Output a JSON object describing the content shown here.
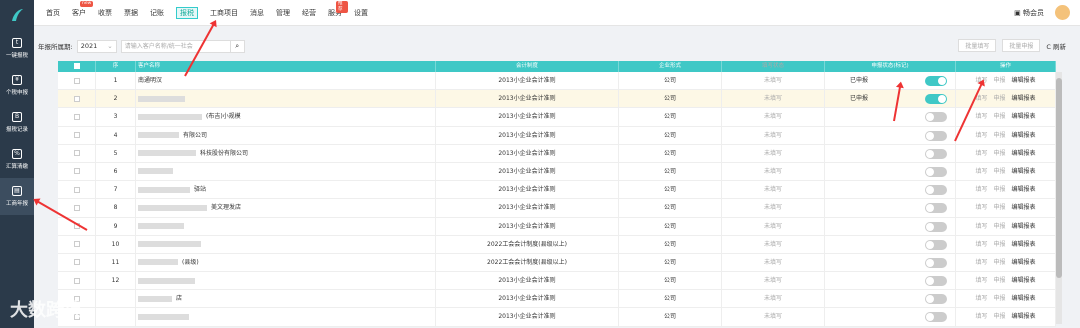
{
  "sidebar": {
    "items": [
      {
        "label": "一键报税",
        "icon": "t"
      },
      {
        "label": "个税申报",
        "icon": "¥"
      },
      {
        "label": "报税记录",
        "icon": "B"
      },
      {
        "label": "汇算清缴",
        "icon": "%"
      },
      {
        "label": "工商年报",
        "icon": "▤"
      }
    ]
  },
  "nav": {
    "items": [
      "首页",
      "客户",
      "收票",
      "票据",
      "记账",
      "报税",
      "工商项目",
      "消息",
      "管理",
      "经营",
      "服务",
      "设置"
    ],
    "badges": {
      "客户": "new",
      "服务": "推荐"
    },
    "active": "报税"
  },
  "member": "畅会员",
  "toolbar": {
    "period_label": "年报所属期:",
    "year": "2021",
    "search_placeholder": "请输入客户名称/统一社会",
    "btn1": "批量填写",
    "btn2": "批量申报",
    "refresh": "C 刷新"
  },
  "table": {
    "headers": [
      "",
      "序",
      "客户名称",
      "会计制度",
      "企业形式",
      "填写状态",
      "申报状态(标记)",
      "操作"
    ],
    "rows": [
      {
        "no": "1",
        "name": "南通明汉",
        "sys": "2013小企业会计准则",
        "form": "公司",
        "fill": "未填写",
        "status": "已申报",
        "on": true
      },
      {
        "no": "2",
        "name": "",
        "sys": "2013小企业会计准则",
        "form": "公司",
        "fill": "未填写",
        "status": "已申报",
        "on": true
      },
      {
        "no": "3",
        "name": "(布吉)小规模",
        "sys": "2013小企业会计准则",
        "form": "公司",
        "fill": "未填写",
        "status": "",
        "on": false
      },
      {
        "no": "4",
        "name": "有限公司",
        "sys": "2013小企业会计准则",
        "form": "公司",
        "fill": "未填写",
        "status": "",
        "on": false
      },
      {
        "no": "5",
        "name": "科技股份有限公司",
        "sys": "2013小企业会计准则",
        "form": "公司",
        "fill": "未填写",
        "status": "",
        "on": false
      },
      {
        "no": "6",
        "name": "",
        "sys": "2013小企业会计准则",
        "form": "公司",
        "fill": "未填写",
        "status": "",
        "on": false
      },
      {
        "no": "7",
        "name": "驿站",
        "sys": "2013小企业会计准则",
        "form": "公司",
        "fill": "未填写",
        "status": "",
        "on": false
      },
      {
        "no": "8",
        "name": "美文理发店",
        "sys": "2013小企业会计准则",
        "form": "公司",
        "fill": "未填写",
        "status": "",
        "on": false
      },
      {
        "no": "9",
        "name": "",
        "sys": "2013小企业会计准则",
        "form": "公司",
        "fill": "未填写",
        "status": "",
        "on": false
      },
      {
        "no": "10",
        "name": "",
        "sys": "2022工会会计制度(县级以上)",
        "form": "公司",
        "fill": "未填写",
        "status": "",
        "on": false
      },
      {
        "no": "11",
        "name": "(县级)",
        "sys": "2022工会会计制度(县级以上)",
        "form": "公司",
        "fill": "未填写",
        "status": "",
        "on": false
      },
      {
        "no": "12",
        "name": "",
        "sys": "2013小企业会计准则",
        "form": "公司",
        "fill": "未填写",
        "status": "",
        "on": false
      },
      {
        "no": "",
        "name": "店",
        "sys": "2013小企业会计准则",
        "form": "公司",
        "fill": "未填写",
        "status": "",
        "on": false
      },
      {
        "no": "",
        "name": "",
        "sys": "2013小企业会计准则",
        "form": "公司",
        "fill": "未填写",
        "status": "",
        "on": false
      }
    ],
    "ops": [
      "填写",
      "申报",
      "编辑报表"
    ]
  },
  "watermark": "大数跨境"
}
